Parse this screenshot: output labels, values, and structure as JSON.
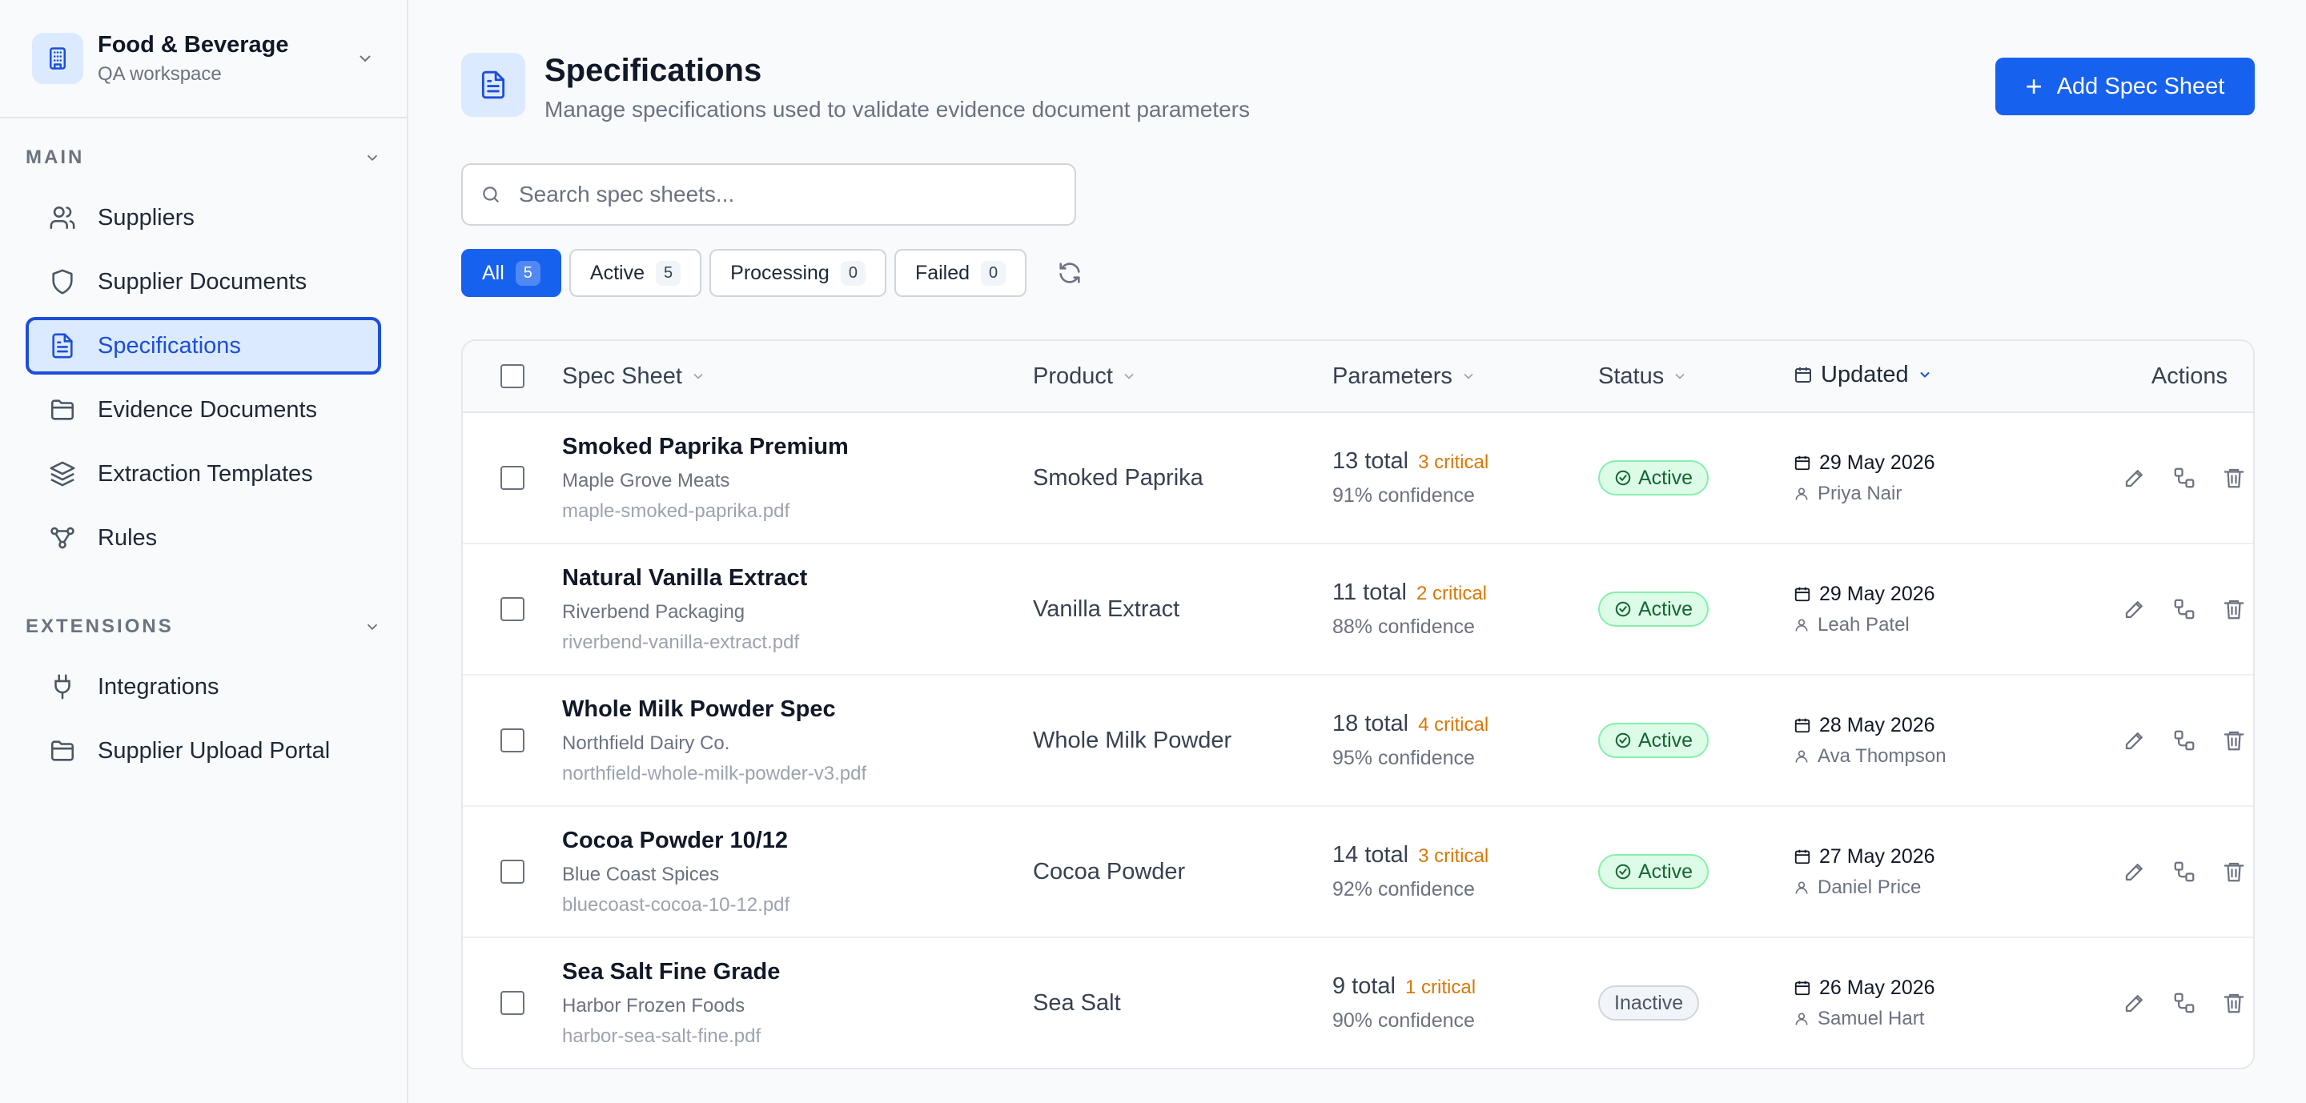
{
  "workspace": {
    "title": "Food & Beverage",
    "subtitle": "QA workspace"
  },
  "sidebar": {
    "main_label": "MAIN",
    "main_items": [
      {
        "label": "Suppliers",
        "icon": "users-icon"
      },
      {
        "label": "Supplier Documents",
        "icon": "shield-icon"
      },
      {
        "label": "Specifications",
        "icon": "document-icon",
        "active": true
      },
      {
        "label": "Evidence Documents",
        "icon": "folder-icon"
      },
      {
        "label": "Extraction Templates",
        "icon": "layers-icon"
      },
      {
        "label": "Rules",
        "icon": "workflow-icon"
      }
    ],
    "extensions_label": "EXTENSIONS",
    "extension_items": [
      {
        "label": "Integrations",
        "icon": "plug-icon"
      },
      {
        "label": "Supplier Upload Portal",
        "icon": "folder-icon"
      }
    ]
  },
  "header": {
    "title": "Specifications",
    "subtitle": "Manage specifications used to validate evidence document parameters",
    "add_button": "Add Spec Sheet"
  },
  "search": {
    "placeholder": "Search spec sheets...",
    "value": ""
  },
  "filters": [
    {
      "label": "All",
      "count": "5",
      "active": true
    },
    {
      "label": "Active",
      "count": "5"
    },
    {
      "label": "Processing",
      "count": "0"
    },
    {
      "label": "Failed",
      "count": "0"
    }
  ],
  "table": {
    "columns": {
      "spec_sheet": "Spec Sheet",
      "product": "Product",
      "parameters": "Parameters",
      "status": "Status",
      "updated": "Updated",
      "actions": "Actions"
    },
    "rows": [
      {
        "name": "Smoked Paprika Premium",
        "supplier": "Maple Grove Meats",
        "file": "maple-smoked-paprika.pdf",
        "product": "Smoked Paprika",
        "total": "13 total",
        "critical": "3 critical",
        "confidence": "91% confidence",
        "status": "Active",
        "date": "29 May 2026",
        "user": "Priya Nair"
      },
      {
        "name": "Natural Vanilla Extract",
        "supplier": "Riverbend Packaging",
        "file": "riverbend-vanilla-extract.pdf",
        "product": "Vanilla Extract",
        "total": "11 total",
        "critical": "2 critical",
        "confidence": "88% confidence",
        "status": "Active",
        "date": "29 May 2026",
        "user": "Leah Patel"
      },
      {
        "name": "Whole Milk Powder Spec",
        "supplier": "Northfield Dairy Co.",
        "file": "northfield-whole-milk-powder-v3.pdf",
        "product": "Whole Milk Powder",
        "total": "18 total",
        "critical": "4 critical",
        "confidence": "95% confidence",
        "status": "Active",
        "date": "28 May 2026",
        "user": "Ava Thompson"
      },
      {
        "name": "Cocoa Powder 10/12",
        "supplier": "Blue Coast Spices",
        "file": "bluecoast-cocoa-10-12.pdf",
        "product": "Cocoa Powder",
        "total": "14 total",
        "critical": "3 critical",
        "confidence": "92% confidence",
        "status": "Active",
        "date": "27 May 2026",
        "user": "Daniel Price"
      },
      {
        "name": "Sea Salt Fine Grade",
        "supplier": "Harbor Frozen Foods",
        "file": "harbor-sea-salt-fine.pdf",
        "product": "Sea Salt",
        "total": "9 total",
        "critical": "1 critical",
        "confidence": "90% confidence",
        "status": "Inactive",
        "date": "26 May 2026",
        "user": "Samuel Hart"
      }
    ]
  },
  "colors": {
    "accent": "#1761ef",
    "active_badge": "#dcfce7",
    "critical": "#d97706"
  }
}
